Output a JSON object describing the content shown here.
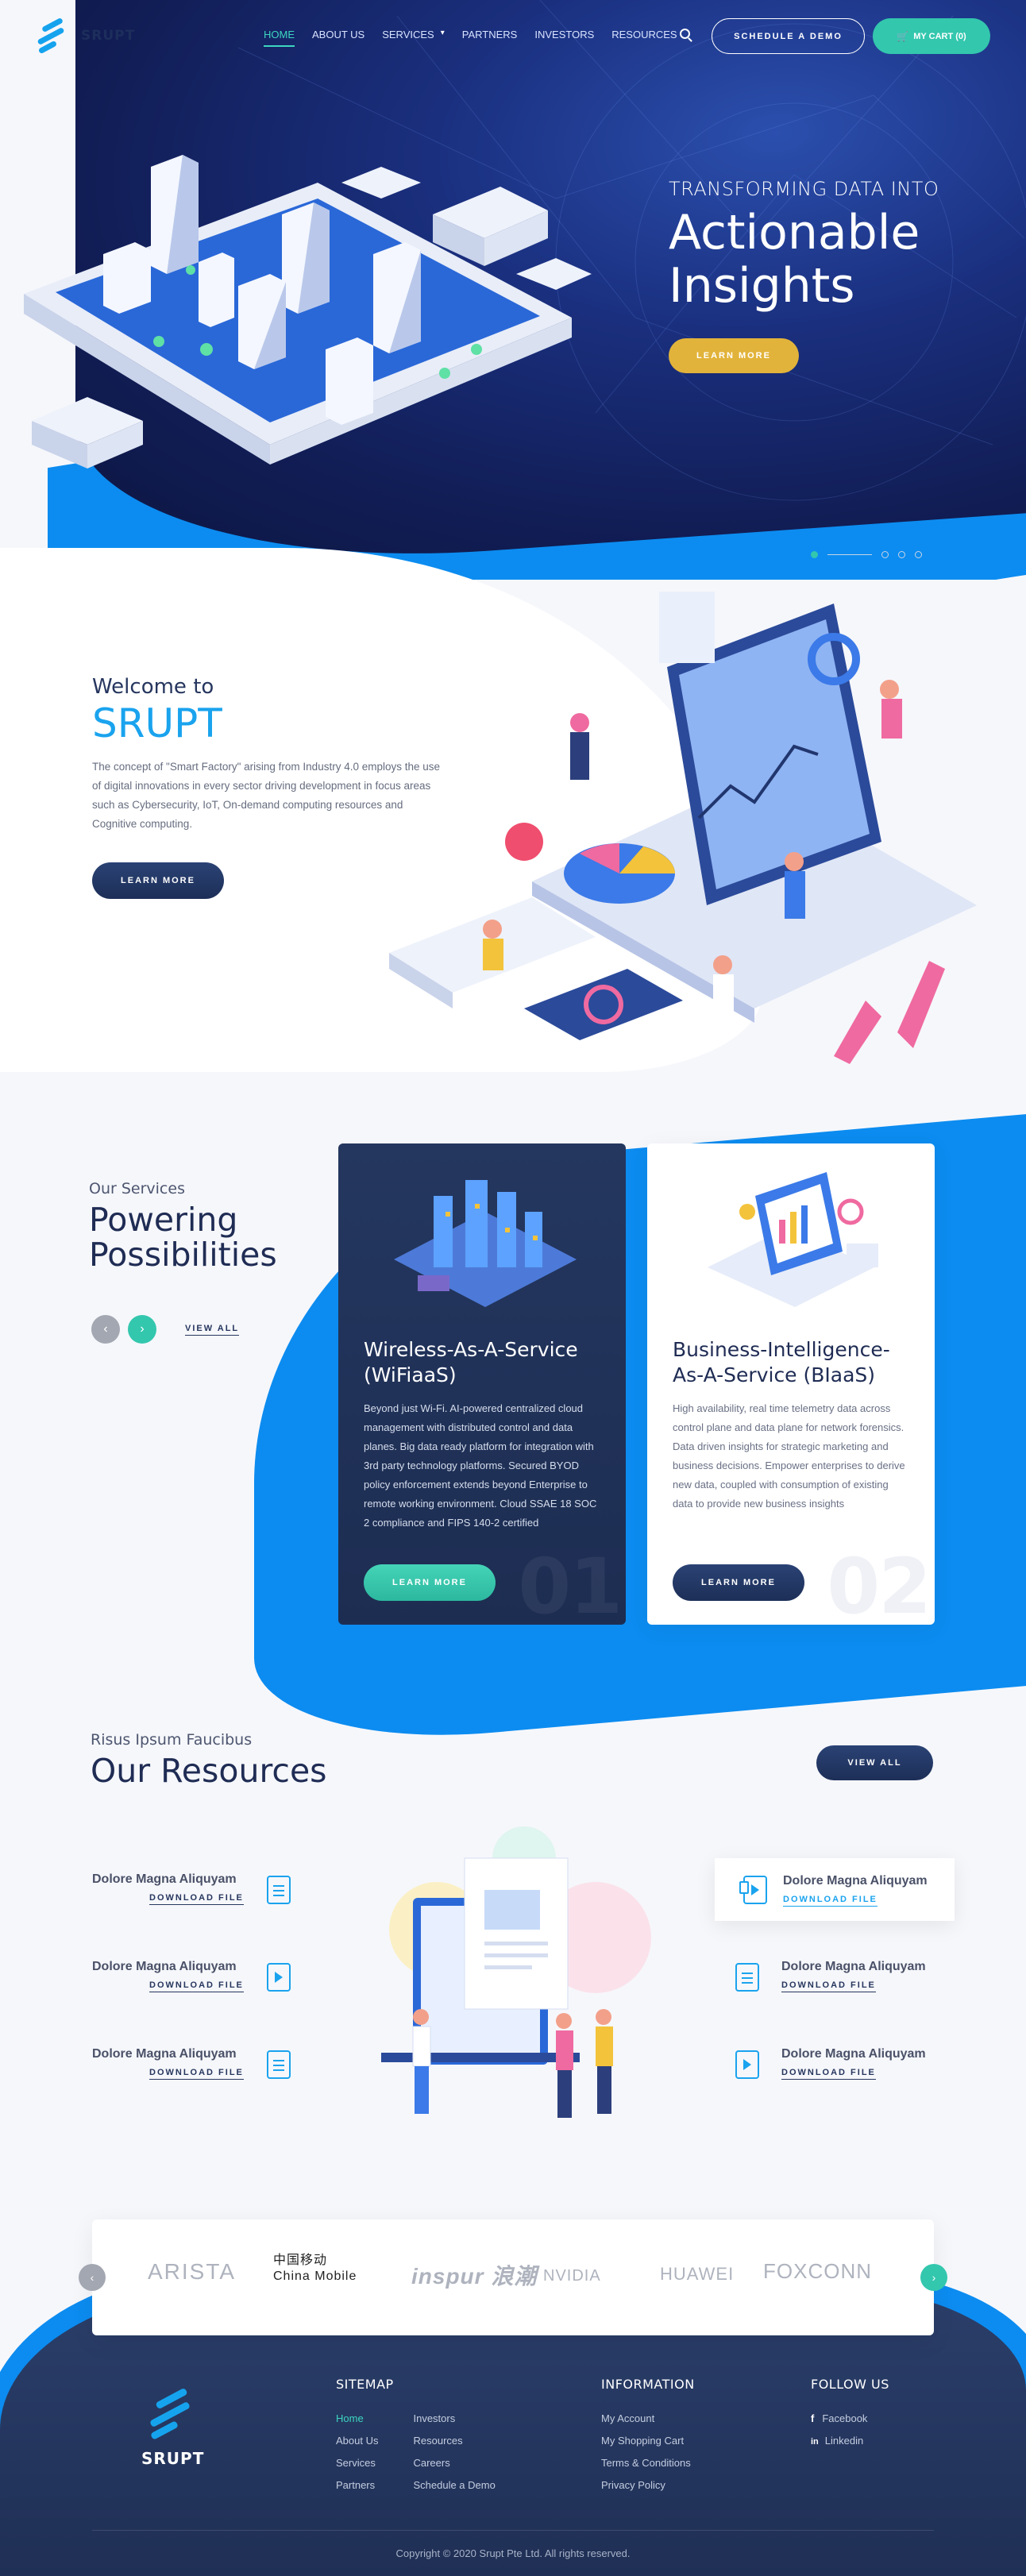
{
  "header": {
    "logo_text": "SRUPT",
    "nav": [
      "HOME",
      "ABOUT US",
      "SERVICES",
      "PARTNERS",
      "INVESTORS",
      "RESOURCES"
    ],
    "schedule_label": "SCHEDULE A DEMO",
    "cart_label": "MY CART (0)"
  },
  "hero": {
    "eyebrow": "TRANSFORMING DATA INTO",
    "title_line1": "Actionable",
    "title_line2": "Insights",
    "cta": "LEARN MORE"
  },
  "welcome": {
    "small": "Welcome to",
    "big": "SRUPT",
    "body": "The concept of \"Smart Factory\" arising from Industry 4.0 employs the use of digital innovations in every sector driving development in focus areas such as Cybersecurity, IoT, On-demand computing resources and Cognitive computing.",
    "cta": "LEARN MORE"
  },
  "services": {
    "eyebrow": "Our Services",
    "title_line1": "Powering",
    "title_line2": "Possibilities",
    "view_all": "VIEW ALL",
    "cards": [
      {
        "title": "Wireless-As-A-Service (WiFiaaS)",
        "body": "Beyond just Wi-Fi. AI-powered centralized cloud management with distributed control and data planes. Big data ready platform for integration with 3rd party technology platforms. Secured BYOD policy enforcement extends beyond Enterprise to remote working environment. Cloud SSAE 18 SOC 2 compliance and FIPS 140-2 certified",
        "cta": "LEARN MORE",
        "num": "01"
      },
      {
        "title": "Business-Intelligence-As-A-Service (BIaaS)",
        "body": "High availability, real time telemetry data across control plane and data plane for network forensics. Data driven insights for strategic marketing and business decisions. Empower enterprises to derive new data, coupled with consumption of existing data to provide new business insights",
        "cta": "LEARN MORE",
        "num": "02"
      }
    ]
  },
  "resources": {
    "eyebrow": "Risus Ipsum Faucibus",
    "title": "Our Resources",
    "view_all": "VIEW ALL",
    "items": [
      {
        "title": "Dolore Magna Aliquyam",
        "link": "DOWNLOAD FILE"
      },
      {
        "title": "Dolore Magna Aliquyam",
        "link": "DOWNLOAD FILE"
      },
      {
        "title": "Dolore Magna Aliquyam",
        "link": "DOWNLOAD FILE"
      },
      {
        "title": "Dolore Magna Aliquyam",
        "link": "DOWNLOAD FILE"
      },
      {
        "title": "Dolore Magna Aliquyam",
        "link": "DOWNLOAD FILE"
      },
      {
        "title": "Dolore Magna Aliquyam",
        "link": "DOWNLOAD FILE"
      }
    ]
  },
  "partners": [
    "ARISTA",
    "中国移动 China Mobile",
    "inspur 浪潮",
    "NVIDIA",
    "HUAWEI",
    "FOXCONN"
  ],
  "footer": {
    "logo_text": "SRUPT",
    "sitemap_title": "SITEMAP",
    "sitemap_col1": [
      "Home",
      "About Us",
      "Services",
      "Partners"
    ],
    "sitemap_col2": [
      "Investors",
      "Resources",
      "Careers",
      "Schedule a Demo"
    ],
    "info_title": "INFORMATION",
    "info": [
      "My Account",
      "My Shopping Cart",
      "Terms & Conditions",
      "Privacy Policy"
    ],
    "follow_title": "FOLLOW US",
    "social": [
      "Facebook",
      "Linkedin"
    ],
    "copyright": "Copyright © 2020 Srupt Pte Ltd. All rights reserved."
  },
  "colors": {
    "accent_teal": "#33c7ae",
    "brand_blue": "#0c8cf0",
    "navy": "#1f2c54",
    "gold": "#e2b33a"
  }
}
